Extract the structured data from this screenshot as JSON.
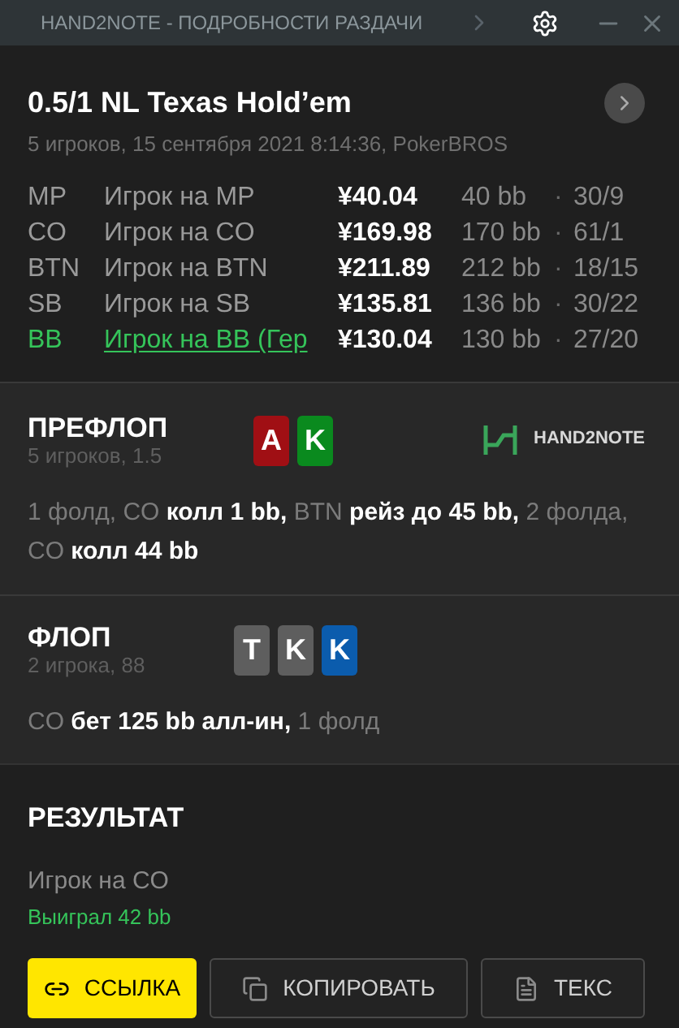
{
  "window": {
    "title": "HAND2NOTE - ПОДРОБНОСТИ РАЗДАЧИ"
  },
  "hand": {
    "title": "0.5/1 NL Texas Hold’em",
    "subtitle": "5 игроков, 15 сентября 2021 8:14:36, PokerBROS"
  },
  "players": [
    {
      "position": "MP",
      "name": "Игрок на MP",
      "stack": "¥40.04",
      "bb": "40 bb",
      "sep": "·",
      "stats": "30/9",
      "hero": false
    },
    {
      "position": "CO",
      "name": "Игрок на CO",
      "stack": "¥169.98",
      "bb": "170 bb",
      "sep": "·",
      "stats": "61/1",
      "hero": false
    },
    {
      "position": "BTN",
      "name": "Игрок на BTN",
      "stack": "¥211.89",
      "bb": "212 bb",
      "sep": "·",
      "stats": "18/15",
      "hero": false
    },
    {
      "position": "SB",
      "name": "Игрок на SB",
      "stack": "¥135.81",
      "bb": "136 bb",
      "sep": "·",
      "stats": "30/22",
      "hero": false
    },
    {
      "position": "BB",
      "name": "Игрок на BB (Гер",
      "stack": "¥130.04",
      "bb": "130 bb",
      "sep": "·",
      "stats": "27/20",
      "hero": true
    }
  ],
  "streets": [
    {
      "name": "ПРЕФЛОП",
      "info": "5 игроков, 1.5",
      "cards": [
        {
          "rank": "A",
          "color": "#a00f14"
        },
        {
          "rank": "K",
          "color": "#0a8a1e"
        }
      ],
      "logo": "HAND2NOTE",
      "actions": "1 фолд, CO **колл 1 bb,** BTN **рейз до 45 bb,** 2 фолда, CO **колл 44 bb**"
    },
    {
      "name": "ФЛОП",
      "info": "2 игрока, 88",
      "cards": [
        {
          "rank": "T",
          "color": "#5e5e5e"
        },
        {
          "rank": "K",
          "color": "#5e5e5e"
        },
        {
          "rank": "K",
          "color": "#0b5cad"
        }
      ],
      "actions": "CO **бет 125 bb алл-ин,** 1 фолд"
    }
  ],
  "result": {
    "title": "РЕЗУЛЬТАТ",
    "player": "Игрок на CO",
    "outcome": "Выиграл 42 bb"
  },
  "buttons": [
    {
      "label": "ССЫЛКА",
      "kind": "link",
      "primary": true
    },
    {
      "label": "КОПИРОВАТЬ",
      "kind": "copy",
      "primary": false
    },
    {
      "label": "ТЕКС",
      "kind": "text",
      "primary": false
    }
  ]
}
